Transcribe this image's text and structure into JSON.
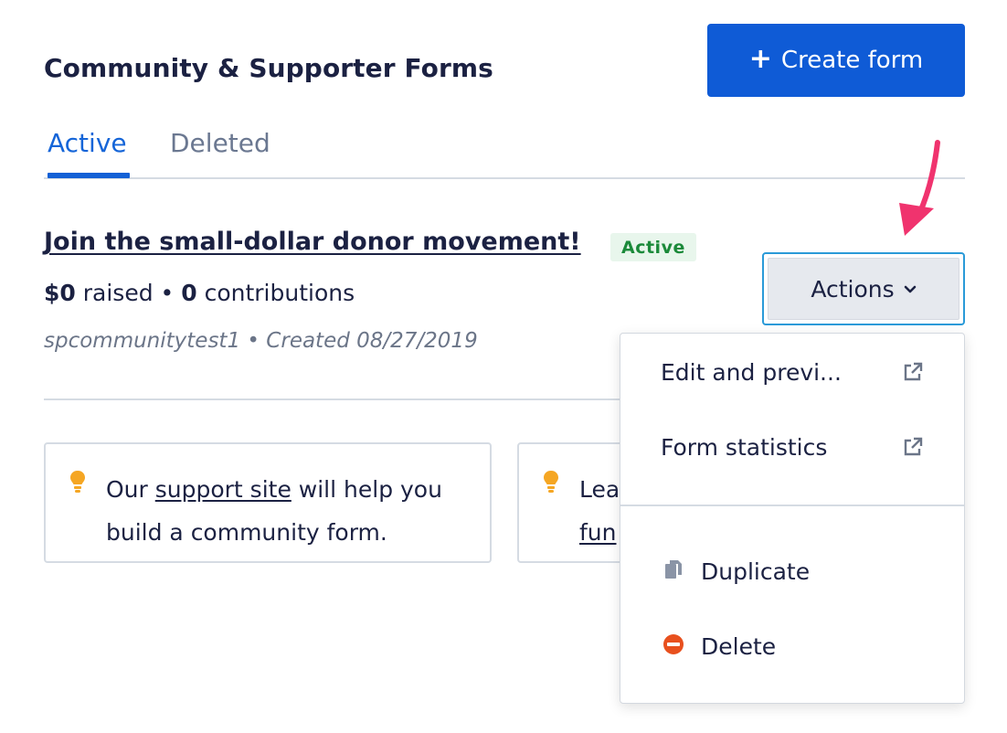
{
  "header": {
    "title": "Community & Supporter Forms",
    "create_button_plus": "+",
    "create_button_label": "Create form"
  },
  "tabs": [
    {
      "label": "Active",
      "active": true
    },
    {
      "label": "Deleted",
      "active": false
    }
  ],
  "form": {
    "title": "Join the small-dollar donor movement!",
    "status": "Active",
    "raised_amount": "$0",
    "raised_label": "raised",
    "separator": "•",
    "contributions_count": "0",
    "contributions_label": "contributions",
    "owner": "spcommunitytest1",
    "created": "Created 08/27/2019"
  },
  "actions": {
    "label": "Actions",
    "chevron": "⌄"
  },
  "dropdown": {
    "items": [
      {
        "label": "Edit and previ...",
        "icon": "external-link-icon"
      },
      {
        "label": "Form statistics",
        "icon": "external-link-icon"
      },
      {
        "label": "Duplicate",
        "icon": "copy-icon"
      },
      {
        "label": "Delete",
        "icon": "delete-circle-icon"
      }
    ]
  },
  "tips": [
    {
      "icon": "lightbulb-icon",
      "before": "Our ",
      "link": "support site",
      "after": " will help you",
      "line2": "build a community form."
    },
    {
      "icon": "lightbulb-icon",
      "line1": "Lea",
      "line2": "fun"
    }
  ],
  "colors": {
    "primary": "#0f5bd6",
    "active_tab": "#1565d8",
    "status_green": "#1b8a3a",
    "focus_ring": "#2a9ad8",
    "annotation_arrow": "#f0336e",
    "bulb": "#f5a623",
    "delete_red": "#e8501e"
  }
}
